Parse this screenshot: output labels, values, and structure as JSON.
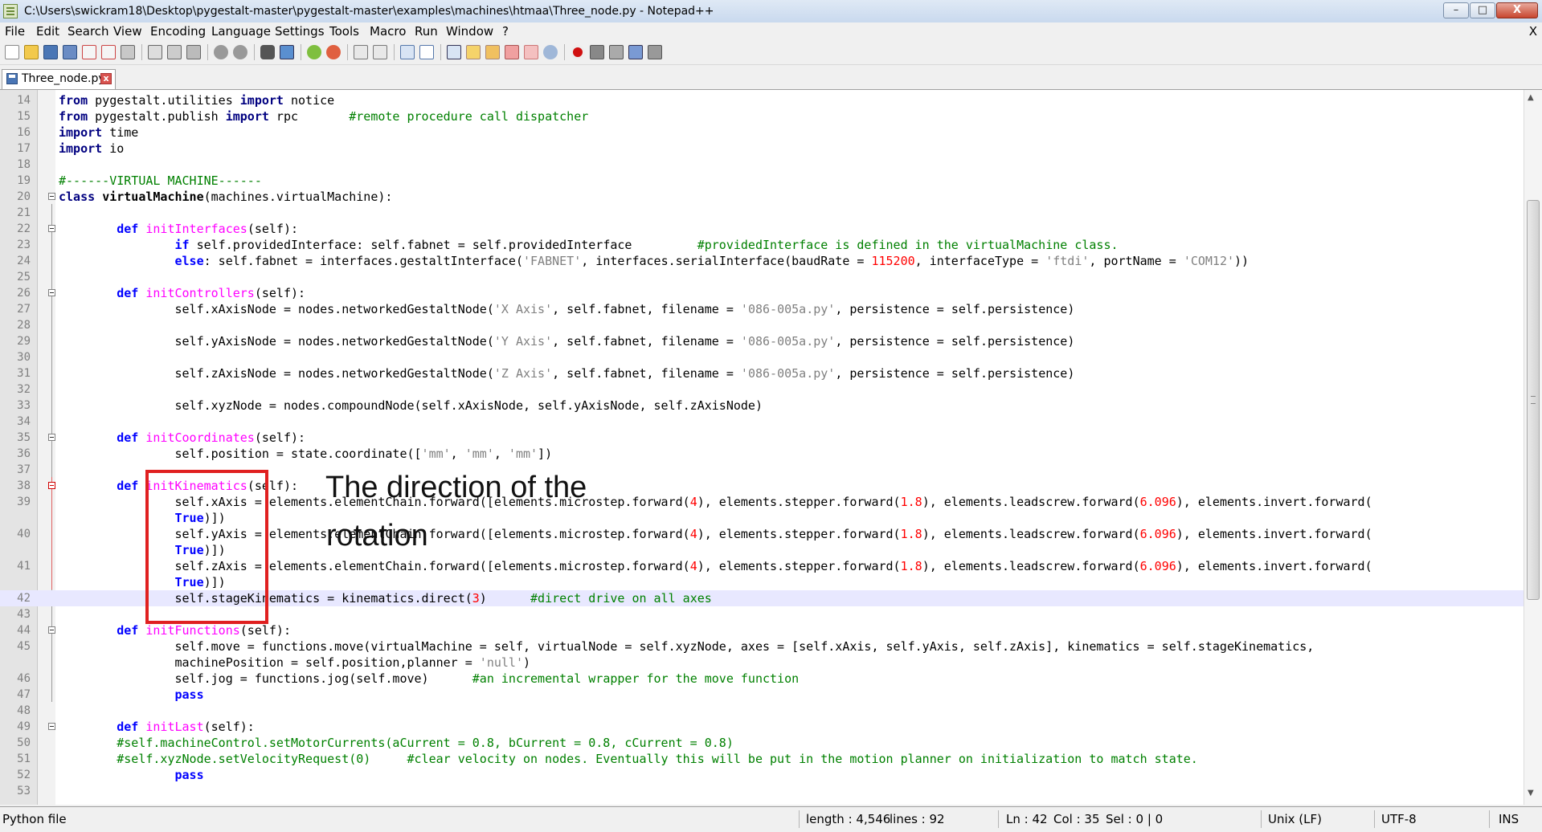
{
  "window": {
    "title": "C:\\Users\\swickram18\\Desktop\\pygestalt-master\\pygestalt-master\\examples\\machines\\htmaa\\Three_node.py - Notepad++",
    "min_label": "–",
    "max_label": "□",
    "close_label": "X"
  },
  "menu": [
    "File",
    "Edit",
    "Search",
    "View",
    "Encoding",
    "Language",
    "Settings",
    "Tools",
    "Macro",
    "Run",
    "Window",
    "?"
  ],
  "menu_close": "X",
  "toolbar_icons": [
    "new-file-icon",
    "open-file-icon",
    "save-icon",
    "save-all-icon",
    "close-icon",
    "close-all-icon",
    "print-icon",
    "cut-icon",
    "copy-icon",
    "paste-icon",
    "undo-icon",
    "redo-icon",
    "find-icon",
    "replace-icon",
    "zoom-in-icon",
    "zoom-out-icon",
    "sync-vertical-icon",
    "sync-horizontal-icon",
    "word-wrap-icon",
    "show-all-chars-icon",
    "indent-guide-icon",
    "user-lang-icon",
    "doc-map-icon",
    "function-list-icon",
    "folder-workspace-icon",
    "monitor-icon",
    "record-macro-icon",
    "stop-record-icon",
    "play-macro-icon",
    "run-macro-multiple-icon",
    "save-macro-icon"
  ],
  "tab": {
    "label": "Three_node.py",
    "close": "x"
  },
  "lines": [
    {
      "n": "14",
      "t": "from pygestalt.utilities import notice"
    },
    {
      "n": "15",
      "t": "from pygestalt.publish import rpc       #remote procedure call dispatcher"
    },
    {
      "n": "16",
      "t": "import time"
    },
    {
      "n": "17",
      "t": "import io"
    },
    {
      "n": "18",
      "t": ""
    },
    {
      "n": "19",
      "t": "#------VIRTUAL MACHINE------"
    },
    {
      "n": "20",
      "t": "class virtualMachine(machines.virtualMachine):"
    },
    {
      "n": "21",
      "t": ""
    },
    {
      "n": "22",
      "t": "def initInterfaces(self):"
    },
    {
      "n": "23",
      "t": "if self.providedInterface: self.fabnet = self.providedInterface         #providedInterface is defined in the virtualMachine class."
    },
    {
      "n": "24",
      "t": "else: self.fabnet = interfaces.gestaltInterface('FABNET', interfaces.serialInterface(baudRate = 115200, interfaceType = 'ftdi', portName = 'COM12'))"
    },
    {
      "n": "25",
      "t": ""
    },
    {
      "n": "26",
      "t": "def initControllers(self):"
    },
    {
      "n": "27",
      "t": "self.xAxisNode = nodes.networkedGestaltNode('X Axis', self.fabnet, filename = '086-005a.py', persistence = self.persistence)"
    },
    {
      "n": "28",
      "t": ""
    },
    {
      "n": "29",
      "t": "self.yAxisNode = nodes.networkedGestaltNode('Y Axis', self.fabnet, filename = '086-005a.py', persistence = self.persistence)"
    },
    {
      "n": "30",
      "t": ""
    },
    {
      "n": "31",
      "t": "self.zAxisNode = nodes.networkedGestaltNode('Z Axis', self.fabnet, filename = '086-005a.py', persistence = self.persistence)"
    },
    {
      "n": "32",
      "t": ""
    },
    {
      "n": "33",
      "t": "self.xyzNode = nodes.compoundNode(self.xAxisNode, self.yAxisNode, self.zAxisNode)"
    },
    {
      "n": "34",
      "t": ""
    },
    {
      "n": "35",
      "t": "def initCoordinates(self):"
    },
    {
      "n": "36",
      "t": "self.position = state.coordinate(['mm', 'mm', 'mm'])"
    },
    {
      "n": "37",
      "t": ""
    },
    {
      "n": "38",
      "t": "def initKinematics(self):"
    },
    {
      "n": "39",
      "t": "self.xAxis = elements.elementChain.forward([elements.microstep.forward(4), elements.stepper.forward(1.8), elements.leadscrew.forward(6.096), elements.invert.forward("
    },
    {
      "n": "",
      "t": "True)])"
    },
    {
      "n": "40",
      "t": "self.yAxis = elements.elementChain.forward([elements.microstep.forward(4), elements.stepper.forward(1.8), elements.leadscrew.forward(6.096), elements.invert.forward("
    },
    {
      "n": "",
      "t": "True)])"
    },
    {
      "n": "41",
      "t": "self.zAxis = elements.elementChain.forward([elements.microstep.forward(4), elements.stepper.forward(1.8), elements.leadscrew.forward(6.096), elements.invert.forward("
    },
    {
      "n": "",
      "t": "True)])"
    },
    {
      "n": "42",
      "t": "self.stageKinematics = kinematics.direct(3)      #direct drive on all axes"
    },
    {
      "n": "43",
      "t": ""
    },
    {
      "n": "44",
      "t": "def initFunctions(self):"
    },
    {
      "n": "45",
      "t": "self.move = functions.move(virtualMachine = self, virtualNode = self.xyzNode, axes = [self.xAxis, self.yAxis, self.zAxis], kinematics = self.stageKinematics,"
    },
    {
      "n": "",
      "t": "machinePosition = self.position,planner = 'null')"
    },
    {
      "n": "46",
      "t": "self.jog = functions.jog(self.move)      #an incremental wrapper for the move function"
    },
    {
      "n": "47",
      "t": "pass"
    },
    {
      "n": "48",
      "t": ""
    },
    {
      "n": "49",
      "t": "def initLast(self):"
    },
    {
      "n": "50",
      "t": "#self.machineControl.setMotorCurrents(aCurrent = 0.8, bCurrent = 0.8, cCurrent = 0.8)"
    },
    {
      "n": "51",
      "t": "#self.xyzNode.setVelocityRequest(0)     #clear velocity on nodes. Eventually this will be put in the motion planner on initialization to match state."
    },
    {
      "n": "52",
      "t": "pass"
    },
    {
      "n": "53",
      "t": ""
    }
  ],
  "annotation": {
    "line1": "The direction of the",
    "line2": "rotation"
  },
  "status": {
    "filetype": "Python file",
    "length": "length : 4,546",
    "lines": "lines : 92",
    "ln": "Ln : 42",
    "col": "Col : 35",
    "sel": "Sel : 0 | 0",
    "eol": "Unix (LF)",
    "encoding": "UTF-8",
    "mode": "INS"
  }
}
